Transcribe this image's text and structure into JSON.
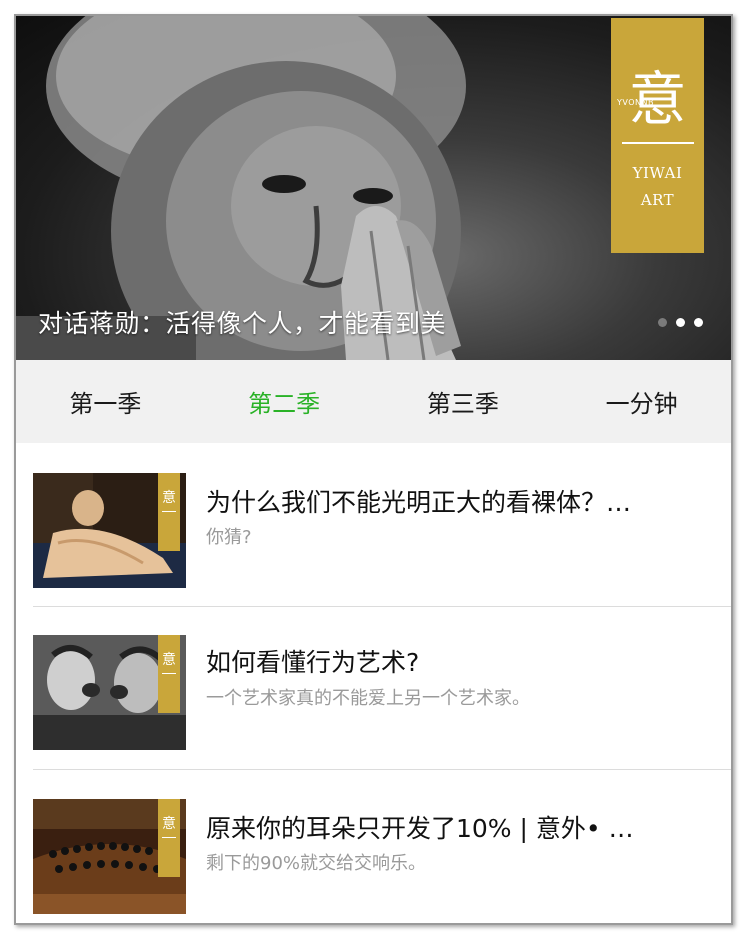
{
  "hero": {
    "caption": "对话蒋勋：活得像个人，才能看到美",
    "logo": {
      "glyph": "意",
      "small_text": "YVONNB",
      "line1": "YIWAI",
      "line2": "ART"
    },
    "slides_total": 3,
    "active_slide": 3
  },
  "tabs": [
    {
      "label": "第一季",
      "active": false
    },
    {
      "label": "第二季",
      "active": true
    },
    {
      "label": "第三季",
      "active": false
    },
    {
      "label": "一分钟",
      "active": false
    }
  ],
  "articles": [
    {
      "title": "为什么我们不能光明正大的看裸体？…",
      "subtitle": "你猜?",
      "thumb": "painting-reclining-nude",
      "tag": "意"
    },
    {
      "title": "如何看懂行为艺术?",
      "subtitle": "一个艺术家真的不能爱上另一个艺术家。",
      "thumb": "two-people-shouting",
      "tag": "意"
    },
    {
      "title": "原来你的耳朵只开发了10% | 意外• …",
      "subtitle": "剩下的90%就交给交响乐。",
      "thumb": "orchestra-concert-hall",
      "tag": "意"
    }
  ],
  "colors": {
    "accent_green": "#2ab227",
    "brand_gold": "#c9a63a",
    "tab_bar_bg": "#f1f1f1"
  }
}
